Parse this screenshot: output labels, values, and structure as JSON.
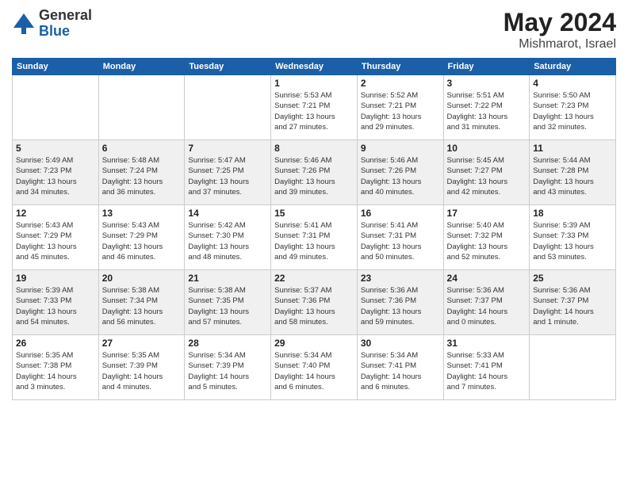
{
  "header": {
    "logo_general": "General",
    "logo_blue": "Blue",
    "month_year": "May 2024",
    "location": "Mishmarot, Israel"
  },
  "days_of_week": [
    "Sunday",
    "Monday",
    "Tuesday",
    "Wednesday",
    "Thursday",
    "Friday",
    "Saturday"
  ],
  "weeks": [
    {
      "shaded": false,
      "days": [
        {
          "num": "",
          "info": ""
        },
        {
          "num": "",
          "info": ""
        },
        {
          "num": "",
          "info": ""
        },
        {
          "num": "1",
          "info": "Sunrise: 5:53 AM\nSunset: 7:21 PM\nDaylight: 13 hours\nand 27 minutes."
        },
        {
          "num": "2",
          "info": "Sunrise: 5:52 AM\nSunset: 7:21 PM\nDaylight: 13 hours\nand 29 minutes."
        },
        {
          "num": "3",
          "info": "Sunrise: 5:51 AM\nSunset: 7:22 PM\nDaylight: 13 hours\nand 31 minutes."
        },
        {
          "num": "4",
          "info": "Sunrise: 5:50 AM\nSunset: 7:23 PM\nDaylight: 13 hours\nand 32 minutes."
        }
      ]
    },
    {
      "shaded": true,
      "days": [
        {
          "num": "5",
          "info": "Sunrise: 5:49 AM\nSunset: 7:23 PM\nDaylight: 13 hours\nand 34 minutes."
        },
        {
          "num": "6",
          "info": "Sunrise: 5:48 AM\nSunset: 7:24 PM\nDaylight: 13 hours\nand 36 minutes."
        },
        {
          "num": "7",
          "info": "Sunrise: 5:47 AM\nSunset: 7:25 PM\nDaylight: 13 hours\nand 37 minutes."
        },
        {
          "num": "8",
          "info": "Sunrise: 5:46 AM\nSunset: 7:26 PM\nDaylight: 13 hours\nand 39 minutes."
        },
        {
          "num": "9",
          "info": "Sunrise: 5:46 AM\nSunset: 7:26 PM\nDaylight: 13 hours\nand 40 minutes."
        },
        {
          "num": "10",
          "info": "Sunrise: 5:45 AM\nSunset: 7:27 PM\nDaylight: 13 hours\nand 42 minutes."
        },
        {
          "num": "11",
          "info": "Sunrise: 5:44 AM\nSunset: 7:28 PM\nDaylight: 13 hours\nand 43 minutes."
        }
      ]
    },
    {
      "shaded": false,
      "days": [
        {
          "num": "12",
          "info": "Sunrise: 5:43 AM\nSunset: 7:29 PM\nDaylight: 13 hours\nand 45 minutes."
        },
        {
          "num": "13",
          "info": "Sunrise: 5:43 AM\nSunset: 7:29 PM\nDaylight: 13 hours\nand 46 minutes."
        },
        {
          "num": "14",
          "info": "Sunrise: 5:42 AM\nSunset: 7:30 PM\nDaylight: 13 hours\nand 48 minutes."
        },
        {
          "num": "15",
          "info": "Sunrise: 5:41 AM\nSunset: 7:31 PM\nDaylight: 13 hours\nand 49 minutes."
        },
        {
          "num": "16",
          "info": "Sunrise: 5:41 AM\nSunset: 7:31 PM\nDaylight: 13 hours\nand 50 minutes."
        },
        {
          "num": "17",
          "info": "Sunrise: 5:40 AM\nSunset: 7:32 PM\nDaylight: 13 hours\nand 52 minutes."
        },
        {
          "num": "18",
          "info": "Sunrise: 5:39 AM\nSunset: 7:33 PM\nDaylight: 13 hours\nand 53 minutes."
        }
      ]
    },
    {
      "shaded": true,
      "days": [
        {
          "num": "19",
          "info": "Sunrise: 5:39 AM\nSunset: 7:33 PM\nDaylight: 13 hours\nand 54 minutes."
        },
        {
          "num": "20",
          "info": "Sunrise: 5:38 AM\nSunset: 7:34 PM\nDaylight: 13 hours\nand 56 minutes."
        },
        {
          "num": "21",
          "info": "Sunrise: 5:38 AM\nSunset: 7:35 PM\nDaylight: 13 hours\nand 57 minutes."
        },
        {
          "num": "22",
          "info": "Sunrise: 5:37 AM\nSunset: 7:36 PM\nDaylight: 13 hours\nand 58 minutes."
        },
        {
          "num": "23",
          "info": "Sunrise: 5:36 AM\nSunset: 7:36 PM\nDaylight: 13 hours\nand 59 minutes."
        },
        {
          "num": "24",
          "info": "Sunrise: 5:36 AM\nSunset: 7:37 PM\nDaylight: 14 hours\nand 0 minutes."
        },
        {
          "num": "25",
          "info": "Sunrise: 5:36 AM\nSunset: 7:37 PM\nDaylight: 14 hours\nand 1 minute."
        }
      ]
    },
    {
      "shaded": false,
      "days": [
        {
          "num": "26",
          "info": "Sunrise: 5:35 AM\nSunset: 7:38 PM\nDaylight: 14 hours\nand 3 minutes."
        },
        {
          "num": "27",
          "info": "Sunrise: 5:35 AM\nSunset: 7:39 PM\nDaylight: 14 hours\nand 4 minutes."
        },
        {
          "num": "28",
          "info": "Sunrise: 5:34 AM\nSunset: 7:39 PM\nDaylight: 14 hours\nand 5 minutes."
        },
        {
          "num": "29",
          "info": "Sunrise: 5:34 AM\nSunset: 7:40 PM\nDaylight: 14 hours\nand 6 minutes."
        },
        {
          "num": "30",
          "info": "Sunrise: 5:34 AM\nSunset: 7:41 PM\nDaylight: 14 hours\nand 6 minutes."
        },
        {
          "num": "31",
          "info": "Sunrise: 5:33 AM\nSunset: 7:41 PM\nDaylight: 14 hours\nand 7 minutes."
        },
        {
          "num": "",
          "info": ""
        }
      ]
    }
  ]
}
